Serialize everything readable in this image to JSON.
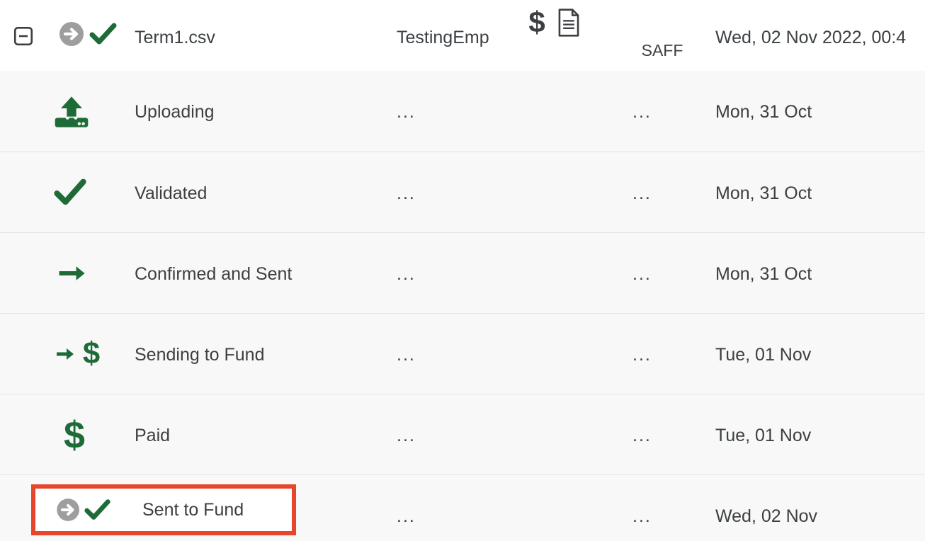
{
  "table": {
    "header": {
      "toggle_icon": "collapse-minus-icon",
      "status_icon": "circle-arrow-check-icon",
      "file_name": "Term1.csv",
      "employer": "TestingEmp",
      "amount_icon": "dollar-icon",
      "document_icon": "document-icon",
      "fund_label": "SAFF",
      "date": "Wed, 02 Nov 2022, 00:4"
    },
    "rows": [
      {
        "icon": "upload-icon",
        "status": "Uploading",
        "col3": "...",
        "col4": "...",
        "date": "Mon, 31 Oct",
        "highlighted": false
      },
      {
        "icon": "check-icon",
        "status": "Validated",
        "col3": "...",
        "col4": "...",
        "date": "Mon, 31 Oct",
        "highlighted": false
      },
      {
        "icon": "arrow-right-icon",
        "status": "Confirmed and Sent",
        "col3": "...",
        "col4": "...",
        "date": "Mon, 31 Oct",
        "highlighted": false
      },
      {
        "icon": "arrow-dollar-icon",
        "status": "Sending to Fund",
        "col3": "...",
        "col4": "...",
        "date": "Tue, 01 Nov",
        "highlighted": false
      },
      {
        "icon": "dollar-icon",
        "status": "Paid",
        "col3": "...",
        "col4": "...",
        "date": "Tue, 01 Nov",
        "highlighted": false
      },
      {
        "icon": "circle-arrow-check-icon",
        "status": "Sent to Fund",
        "col3": "...",
        "col4": "...",
        "date": "Wed, 02 Nov",
        "highlighted": true
      }
    ]
  },
  "annotation": {
    "type": "highlight-rectangle",
    "color": "#e8462c",
    "target_label": "Sent to Fund"
  },
  "colors": {
    "green": "#1e6b37",
    "gray_circle": "#9e9e9e",
    "text": "#3c4043",
    "row_background": "#f8f8f8",
    "header_background": "#ffffff",
    "separator": "#e3e3e3",
    "highlight_red": "#e8462c"
  }
}
